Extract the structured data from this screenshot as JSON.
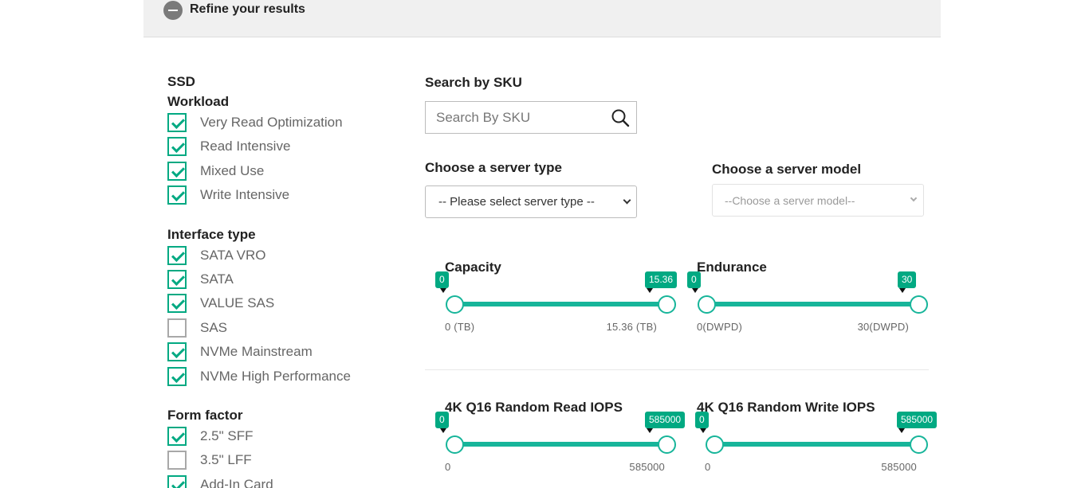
{
  "refine": {
    "title": "Refine your results"
  },
  "filters": {
    "ssd_label": "SSD",
    "workload": {
      "title": "Workload",
      "items": [
        {
          "label": "Very Read Optimization",
          "checked": true
        },
        {
          "label": "Read Intensive",
          "checked": true
        },
        {
          "label": "Mixed Use",
          "checked": true
        },
        {
          "label": "Write Intensive",
          "checked": true
        }
      ]
    },
    "interface": {
      "title": "Interface type",
      "items": [
        {
          "label": "SATA VRO",
          "checked": true
        },
        {
          "label": "SATA",
          "checked": true
        },
        {
          "label": "VALUE SAS",
          "checked": true
        },
        {
          "label": "SAS",
          "checked": false
        },
        {
          "label": "NVMe Mainstream",
          "checked": true
        },
        {
          "label": "NVMe High Performance",
          "checked": true
        }
      ]
    },
    "form_factor": {
      "title": "Form factor",
      "items": [
        {
          "label": "2.5\" SFF",
          "checked": true
        },
        {
          "label": "3.5\" LFF",
          "checked": false
        },
        {
          "label": "Add-In Card",
          "checked": true
        }
      ]
    }
  },
  "sku": {
    "title": "Search by SKU",
    "placeholder": "Search By SKU"
  },
  "server_type": {
    "title": "Choose a server type",
    "selected": "-- Please select server type --"
  },
  "server_model": {
    "title": "Choose a server model",
    "selected": "--Choose a server model--"
  },
  "sliders": {
    "capacity": {
      "title": "Capacity",
      "low_value": "0",
      "high_value": "15.36",
      "min_label": "0 (TB)",
      "max_label": "15.36 (TB)"
    },
    "endurance": {
      "title": "Endurance",
      "low_value": "0",
      "high_value": "30",
      "min_label": "0(DWPD)",
      "max_label": "30(DWPD)"
    },
    "read_iops": {
      "title": "4K Q16 Random Read IOPS",
      "low_value": "0",
      "high_value": "585000",
      "min_label": "0",
      "max_label": "585000"
    },
    "write_iops": {
      "title": "4K Q16 Random Write IOPS",
      "low_value": "0",
      "high_value": "585000",
      "min_label": "0",
      "max_label": "585000"
    }
  },
  "colors": {
    "accent": "#01a982",
    "track": "#17b59a"
  }
}
